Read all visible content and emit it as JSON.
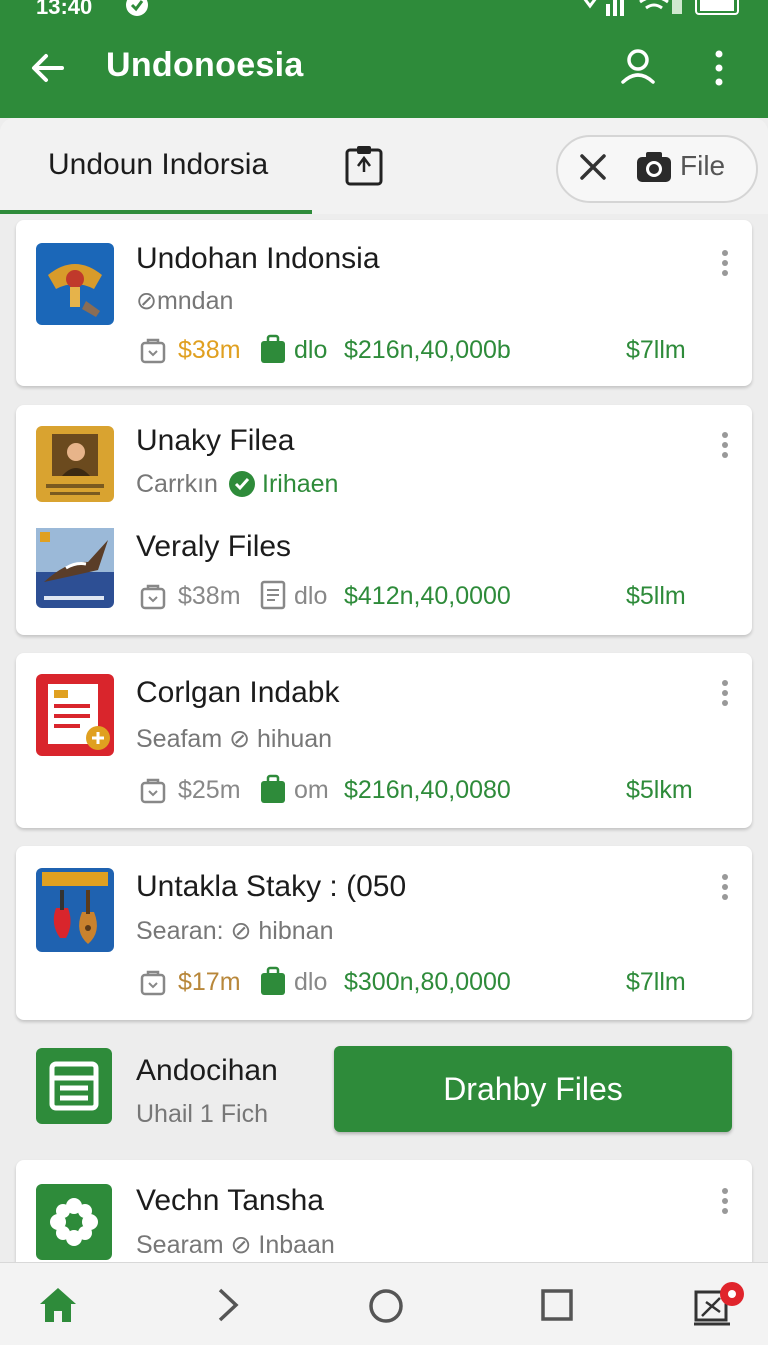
{
  "status": {
    "time": "13:40"
  },
  "appbar": {
    "title": "Undonoesia"
  },
  "tabs": {
    "active_label": "Undoun Indorsia",
    "chip_label": "File"
  },
  "cards": [
    {
      "title": "Undohan Indonsia",
      "subtitle": "⊘mndan",
      "stat1": "$38m",
      "stat2": "dlo",
      "amount": "$216n,40,000b",
      "right": "$7llm"
    },
    {
      "title": "Unaky Filea",
      "subtitle_a": "Carrkın",
      "subtitle_b": "Irihaen",
      "title2": "Veraly Files",
      "stat1": "$38m",
      "stat2": "dlo",
      "amount": "$412n,40,0000",
      "right": "$5llm"
    },
    {
      "title": "Corlgan Indabk",
      "subtitle": "Seafam ⊘ hihuan",
      "stat1": "$25m",
      "stat2": "om",
      "amount": "$216n,40,0080",
      "right": "$5lkm"
    },
    {
      "title": "Untakla Staky : (050",
      "subtitle": "Searan: ⊘ hibnan",
      "stat1": "$17m",
      "stat2": "dlo",
      "amount": "$300n,80,0000",
      "right": "$7llm"
    }
  ],
  "download": {
    "title": "Andocihan",
    "subtitle": "Uhail 1 Fich",
    "button": "Drahby Files"
  },
  "last_card": {
    "title": "Vechn Tansha",
    "subtitle": "Searam ⊘ Inbaan"
  },
  "colors": {
    "primary": "#2e8b3a",
    "accent_orange": "#e0a020",
    "badge_red": "#e0242c"
  },
  "icons": [
    "back-arrow-icon",
    "person-icon",
    "more-vert-icon",
    "clipboard-icon",
    "close-icon",
    "camera-icon",
    "bag-icon",
    "briefcase-icon",
    "check-circle-icon",
    "document-icon",
    "home-icon",
    "chevron-right-icon",
    "circle-icon",
    "square-icon",
    "notification-icon"
  ]
}
